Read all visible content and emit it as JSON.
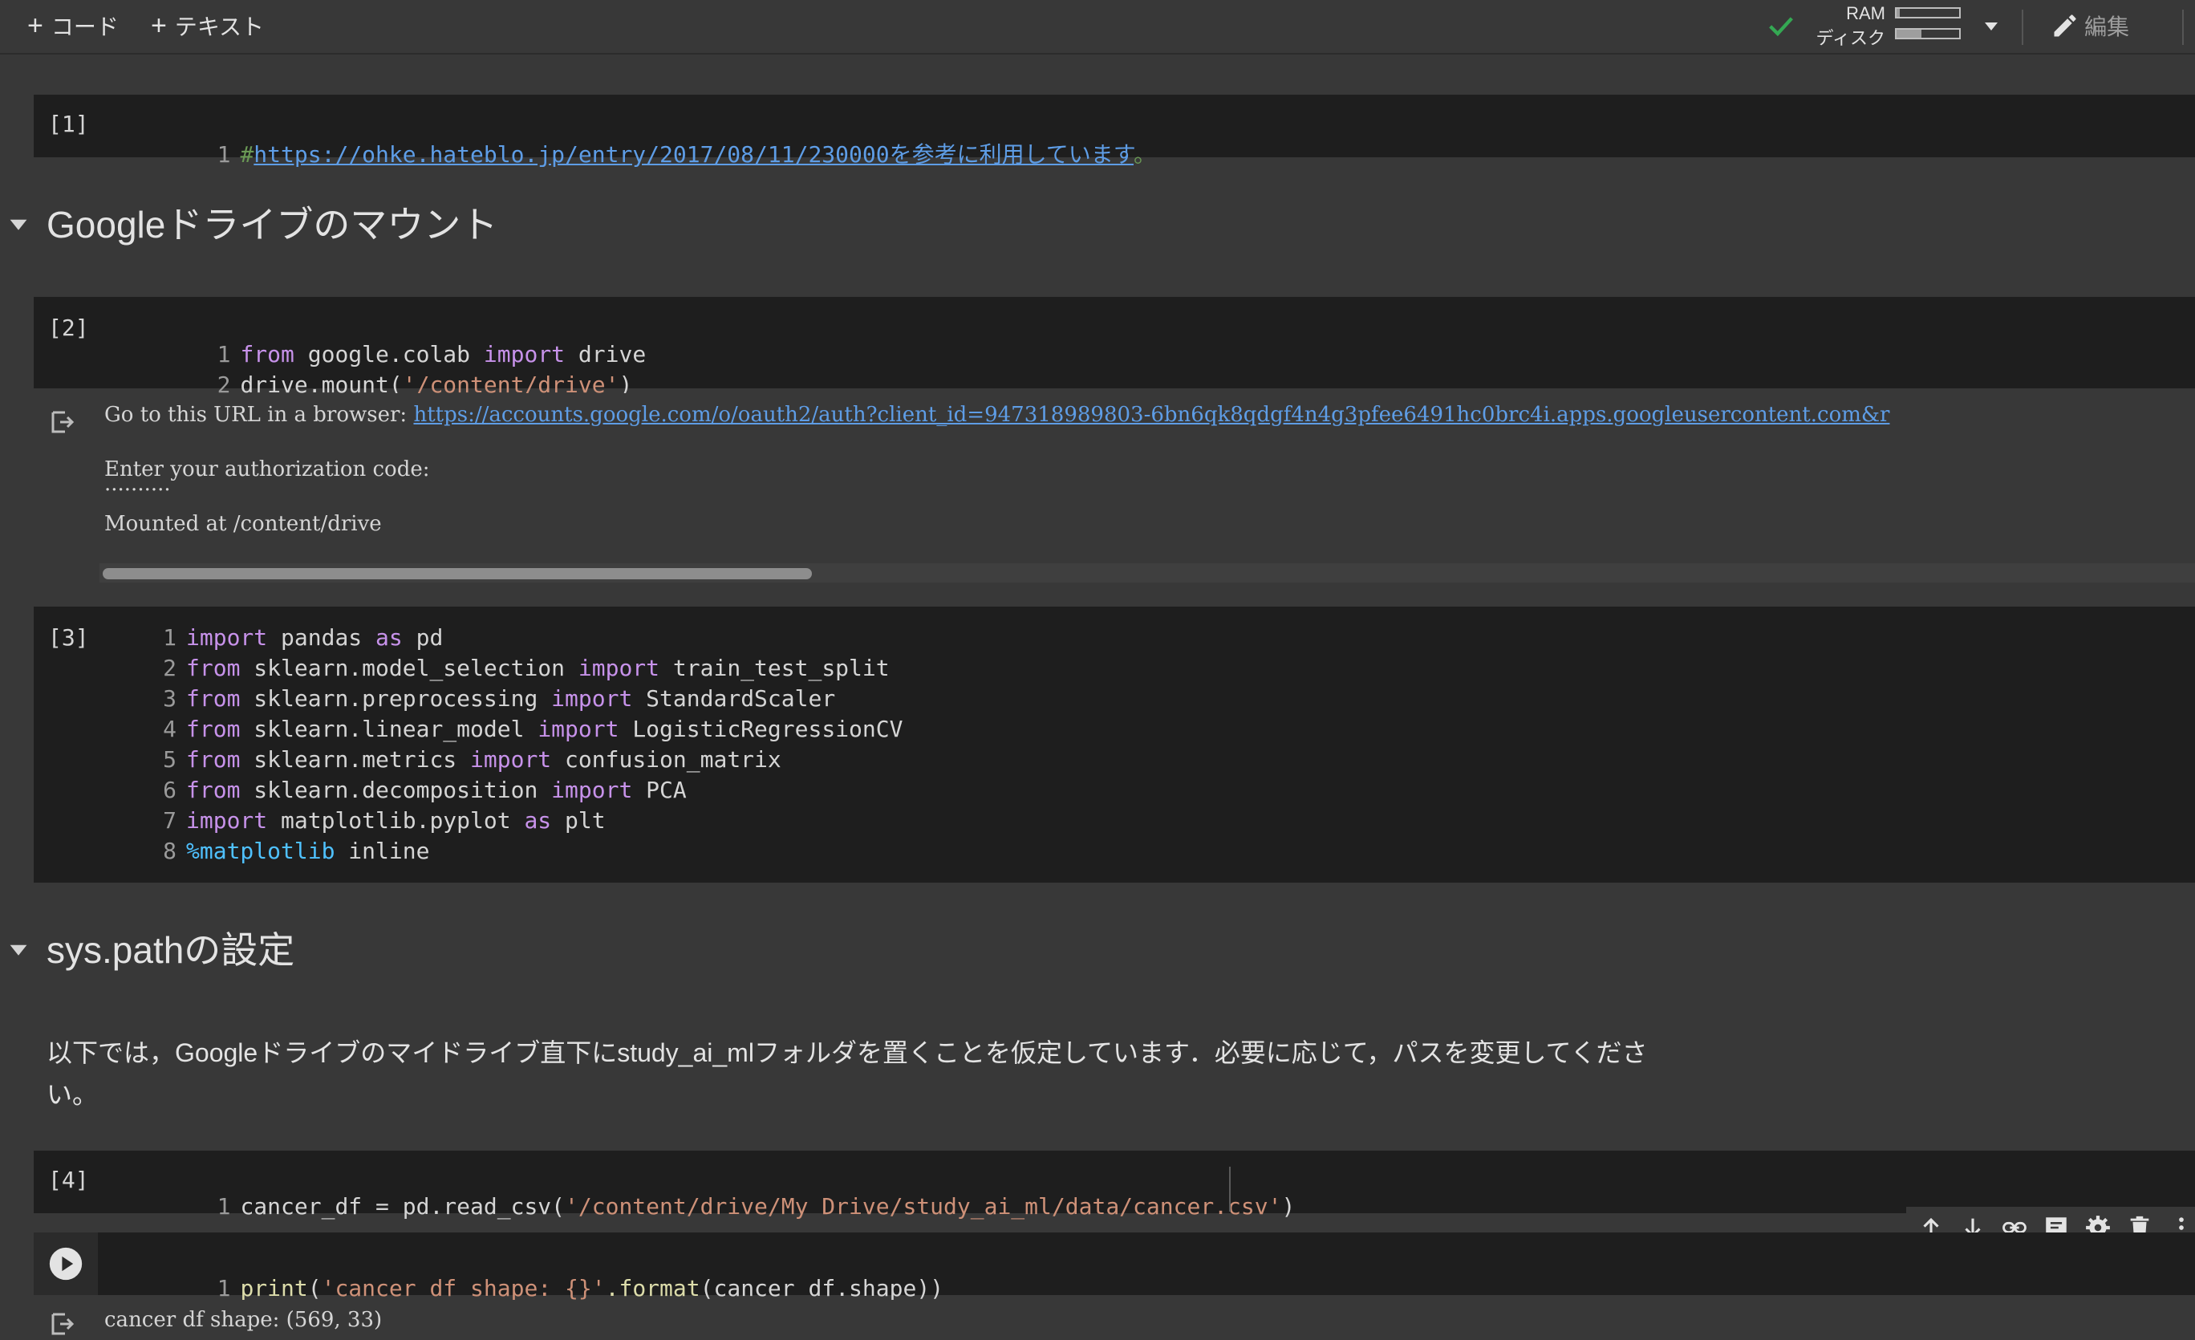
{
  "toolbar": {
    "add_code": "コード",
    "add_text": "テキスト",
    "ram_label": "RAM",
    "disk_label": "ディスク",
    "ram_usage": 0.05,
    "disk_usage": 0.4,
    "edit_label": "編集"
  },
  "cells": [
    {
      "count": "[1]",
      "lines": [
        {
          "n": "1",
          "prefix": "#",
          "link": "https://ohke.hateblo.jp/entry/2017/08/11/230000を参考に利用しています",
          "suffix": "。"
        }
      ]
    },
    {
      "count": "[2]",
      "lines": [
        {
          "n": "1",
          "a": "from",
          "b": " google.colab ",
          "c": "import",
          "d": " drive"
        },
        {
          "n": "2",
          "a": "drive.mount(",
          "b": "'/content/drive'",
          "c": ")"
        }
      ],
      "output": {
        "url_prefix": "Go to this URL in a browser: ",
        "url": "https://accounts.google.com/o/oauth2/auth?client_id=947318989803-6bn6qk8qdgf4n4g3pfee6491hc0brc4i.apps.googleusercontent.com&r",
        "line2": "Enter your authorization code:",
        "line3": "··········",
        "line4": "Mounted at /content/drive"
      }
    },
    {
      "count": "[3]",
      "lines": [
        {
          "n": "1",
          "k1": "import",
          "t1": " pandas ",
          "k2": "as",
          "t2": " pd"
        },
        {
          "n": "2",
          "k1": "from",
          "t1": " sklearn.model_selection ",
          "k2": "import",
          "t2": " train_test_split"
        },
        {
          "n": "3",
          "k1": "from",
          "t1": " sklearn.preprocessing ",
          "k2": "import",
          "t2": " StandardScaler"
        },
        {
          "n": "4",
          "k1": "from",
          "t1": " sklearn.linear_model ",
          "k2": "import",
          "t2": " LogisticRegressionCV"
        },
        {
          "n": "5",
          "k1": "from",
          "t1": " sklearn.metrics ",
          "k2": "import",
          "t2": " confusion_matrix"
        },
        {
          "n": "6",
          "k1": "from",
          "t1": " sklearn.decomposition ",
          "k2": "import",
          "t2": " PCA"
        },
        {
          "n": "7",
          "k1": "import",
          "t1": " matplotlib.pyplot ",
          "k2": "as",
          "t2": " plt"
        },
        {
          "n": "8",
          "k1": "%matplotlib",
          "t1": " inline",
          "k2": "",
          "t2": ""
        }
      ]
    },
    {
      "count": "[4]",
      "lines": [
        {
          "n": "1",
          "a": "cancer_df = pd.read_csv(",
          "b": "'/content/drive/My Drive/study_ai_ml/data/cancer.csv'",
          "c": ")"
        }
      ]
    },
    {
      "lines": [
        {
          "n": "1",
          "a": "print",
          "b": "(",
          "c": "'cancer df shape: {}'",
          "d": ".format",
          "e": "(cancer_df.shape))"
        }
      ],
      "output": {
        "line1": "cancer df shape: (569, 33)"
      }
    }
  ],
  "headings": {
    "mount": "Googleドライブのマウント",
    "syspath": "sys.pathの設定"
  },
  "markdown": {
    "syspath_text": "以下では，Googleドライブのマイドライブ直下にstudy_ai_mlフォルダを置くことを仮定しています．必要に応じて，パスを変更してください。"
  },
  "icons": {
    "cell_toolbar": [
      "arrow-up-icon",
      "arrow-down-icon",
      "link-icon",
      "comment-icon",
      "settings-icon",
      "trash-icon",
      "more-vert-icon"
    ]
  },
  "colors": {
    "background": "#383838",
    "code_bg": "#1e1e1e",
    "keyword": "#c792ea",
    "string": "#ce9178",
    "link": "#5e9de6",
    "check": "#34a853"
  }
}
